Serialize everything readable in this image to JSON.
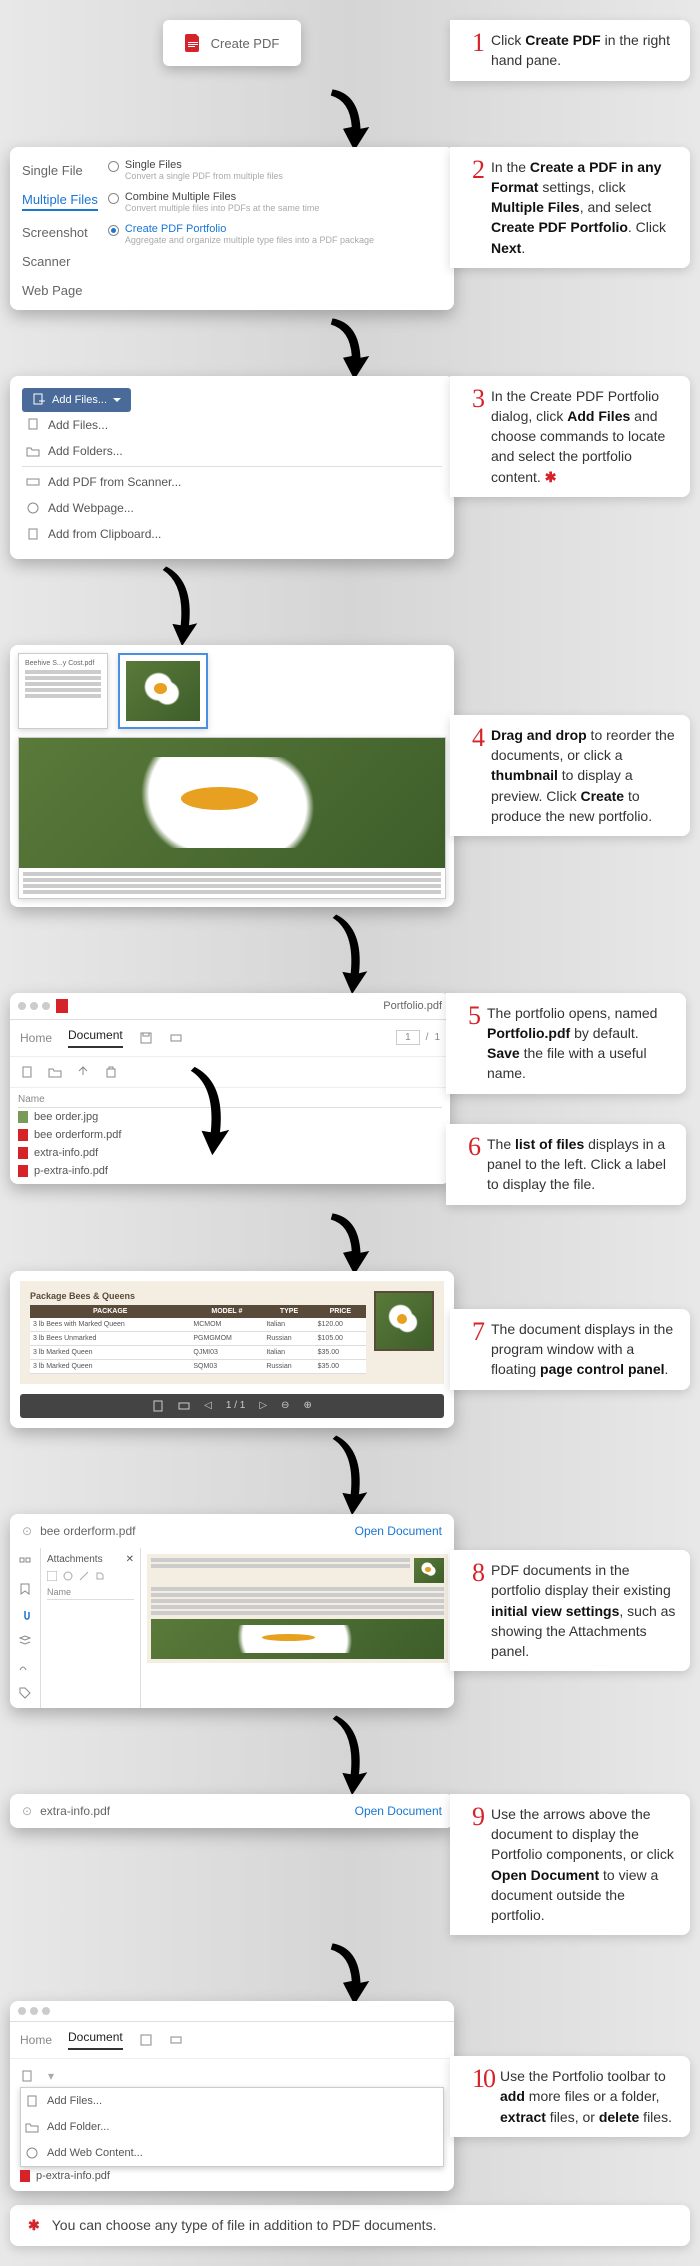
{
  "step1": {
    "button": "Create PDF",
    "text_a": "Click ",
    "text_b": "Create PDF",
    "text_c": " in the right hand pane."
  },
  "step2": {
    "tabs": [
      "Single File",
      "Multiple Files",
      "Screenshot",
      "Scanner",
      "Web Page"
    ],
    "opt1_title": "Single Files",
    "opt1_desc": "Convert a single PDF from multiple files",
    "opt2_title": "Combine Multiple Files",
    "opt2_desc": "Convert multiple files into PDFs at the same time",
    "opt3_title": "Create PDF Portfolio",
    "opt3_desc": "Aggregate and organize multiple type files into a PDF package",
    "text_a": "In the ",
    "b1": "Create a PDF in any Format",
    "text_b": " settings, click ",
    "b2": "Multiple Files",
    "text_c": ", and select ",
    "b3": "Create PDF Portfolio",
    "text_d": ". Click ",
    "b4": "Next",
    "text_e": "."
  },
  "step3": {
    "btn": "Add Files...",
    "m1": "Add Files...",
    "m2": "Add Folders...",
    "m3": "Add PDF from Scanner...",
    "m4": "Add Webpage...",
    "m5": "Add from Clipboard...",
    "text_a": "In the Create PDF Portfolio dialog, click ",
    "b1": "Add Files",
    "text_b": " and choose commands to locate and select the portfolio content. "
  },
  "step4": {
    "thumb1": "Beehive S...y Cost.pdf",
    "b1": "Drag and drop",
    "text_a": " to reorder the documents, or click a ",
    "b2": "thumbnail",
    "text_b": " to display a preview. Click ",
    "b3": "Create",
    "text_c": " to produce the new portfolio."
  },
  "step5": {
    "title": "Portfolio.pdf",
    "tab_home": "Home",
    "tab_doc": "Document",
    "name_hdr": "Name",
    "f1": "bee order.jpg",
    "f2": "bee orderform.pdf",
    "f3": "extra-info.pdf",
    "f4": "p-extra-info.pdf",
    "page": "1",
    "slash": "/",
    "total": "1",
    "text_a": "The portfolio opens, named ",
    "b1": "Portfolio.pdf",
    "text_b": " by default. ",
    "b2": "Save",
    "text_c": " the file with a useful name."
  },
  "step6": {
    "text_a": "The ",
    "b1": "list of files",
    "text_b": " displays in a panel to the left. Click a label to display the file."
  },
  "step7": {
    "pkg_title": "Package Bees & Queens",
    "h1": "PACKAGE",
    "h2": "MODEL #",
    "h3": "TYPE",
    "h4": "PRICE",
    "r1c1": "3 lb Bees with Marked Queen",
    "r1c2": "MCMOM",
    "r1c3": "Italian",
    "r1c4": "$120.00",
    "r2c1": "3 lb Bees Unmarked",
    "r2c2": "PGMGMOM",
    "r2c3": "Russian",
    "r2c4": "$105.00",
    "r3c1": "3 lb Marked Queen",
    "r3c2": "QJMI03",
    "r3c3": "Italian",
    "r3c4": "$35.00",
    "r4c1": "3 lb Marked Queen",
    "r4c2": "SQM03",
    "r4c3": "Russian",
    "r4c4": "$35.00",
    "pc": "1 / 1",
    "text_a": "The document displays in the program window with a floating ",
    "b1": "page control panel",
    "text_b": "."
  },
  "step8": {
    "file": "bee orderform.pdf",
    "open": "Open Document",
    "attach": "Attachments",
    "name": "Name",
    "text_a": "PDF documents in the portfolio display their existing ",
    "b1": "initial view settings",
    "text_b": ", such as showing the Attachments panel."
  },
  "step9": {
    "file": "extra-info.pdf",
    "open": "Open Document",
    "text_a": "Use the arrows above the document to display the Portfolio components, or click ",
    "b1": "Open Document",
    "text_b": " to view a document outside the portfolio."
  },
  "step10": {
    "tab_home": "Home",
    "tab_doc": "Document",
    "m1": "Add Files...",
    "m2": "Add Folder...",
    "m3": "Add Web Content...",
    "f4": "p-extra-info.pdf",
    "text_a": "Use the Portfolio toolbar to ",
    "b1": "add",
    "text_b": " more files or a folder, ",
    "b2": "extract",
    "text_c": " files, or ",
    "b3": "delete",
    "text_d": " files."
  },
  "footer": "You can choose any type of file in addition to PDF documents."
}
